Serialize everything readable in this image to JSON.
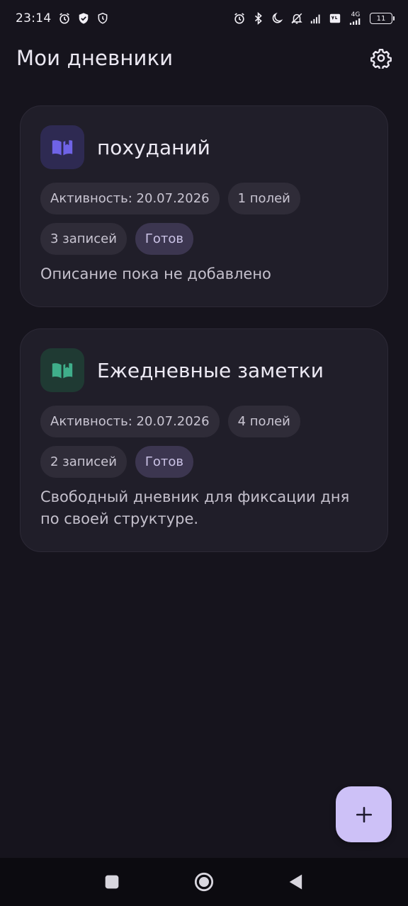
{
  "status_bar": {
    "time": "23:14",
    "network_label": "4G",
    "battery": "11",
    "icons_left": [
      "alarm-icon",
      "shield-check-icon",
      "vpn-shield-icon"
    ],
    "icons_right": [
      "alarm-icon",
      "bluetooth-icon",
      "moon-icon",
      "mute-icon",
      "signal-icon",
      "volte-icon",
      "signal-4g-icon",
      "battery-icon"
    ]
  },
  "header": {
    "title": "Мои дневники",
    "settings_icon": "gear-icon"
  },
  "diaries": [
    {
      "title": "похуданий",
      "icon": "book-open-icon",
      "icon_color": "#6f63e6",
      "icon_bg": "#2e2a52",
      "activity": "Активность: 20.07.2026",
      "fields": "1 полей",
      "entries": "3 записей",
      "status": "Готов",
      "description": "Описание пока не добавлено"
    },
    {
      "title": "Ежедневные заметки",
      "icon": "book-open-icon",
      "icon_color": "#3fae8a",
      "icon_bg": "#1f3a33",
      "activity": "Активность: 20.07.2026",
      "fields": "4 полей",
      "entries": "2 записей",
      "status": "Готов",
      "description": "Свободный дневник для фиксации дня по своей структуре."
    }
  ],
  "fab": {
    "icon": "plus-icon",
    "color": "#cdc1f7"
  },
  "nav_bar": {
    "buttons": [
      "recents-square-icon",
      "home-circle-icon",
      "back-triangle-icon"
    ]
  },
  "colors": {
    "background": "#16141d",
    "card": "#201e29",
    "chip": "#2f2c38",
    "chip_ready": "#3c3650"
  }
}
